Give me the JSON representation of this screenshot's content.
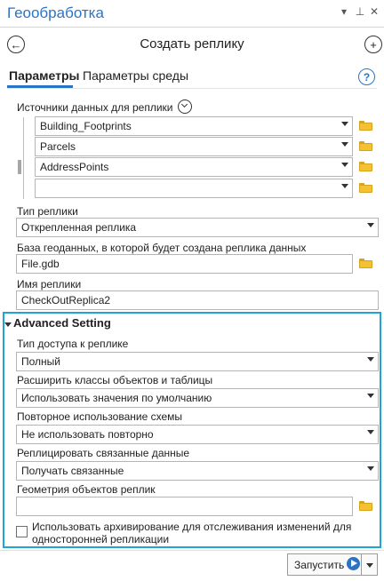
{
  "window": {
    "title": "Геообработка",
    "controls": [
      "▾",
      "⊥",
      "✕"
    ]
  },
  "nav": {
    "back_glyph": "←",
    "add_glyph": "+",
    "tool_title": "Создать реплику"
  },
  "tabs": [
    {
      "label": "Параметры",
      "active": true
    },
    {
      "label": "Параметры среды",
      "active": false
    }
  ],
  "help": {
    "label": "?"
  },
  "data_sources": {
    "label": "Источники данных для реплики",
    "rows": [
      "Building_Footprints",
      "Parcels",
      "AddressPoints",
      ""
    ]
  },
  "replica_type": {
    "label": "Тип реплики",
    "value": "Открепленная реплика"
  },
  "geodatabase": {
    "label": "База геоданных, в которой будет создана реплика данных",
    "value": "File.gdb"
  },
  "replica_name": {
    "label": "Имя реплики",
    "value": "CheckOutReplica2"
  },
  "advanced": {
    "header": "Advanced Setting",
    "access_type": {
      "label": "Тип доступа к реплике",
      "value": "Полный"
    },
    "expand_classes": {
      "label": "Расширить классы объектов и таблицы",
      "value": "Использовать значения по умолчанию"
    },
    "reuse_schema": {
      "label": "Повторное использование схемы",
      "value": "Не использовать повторно"
    },
    "related_data": {
      "label": "Реплицировать связанные данные",
      "value": "Получать связанные"
    },
    "geometry": {
      "label": "Геометрия объектов реплик",
      "value": ""
    },
    "archiving": {
      "label": "Использовать архивирование для отслеживания изменений для односторонней репликации",
      "checked": false
    }
  },
  "run": {
    "label": "Запустить"
  },
  "colors": {
    "accent": "#2a74c5",
    "highlight_border": "#1fa4d6",
    "folder": "#f2c232"
  },
  "icons": [
    "back-arrow-icon",
    "add-icon",
    "help-icon",
    "chevron-down-icon",
    "folder-icon",
    "play-icon",
    "pin-icon",
    "close-icon"
  ]
}
